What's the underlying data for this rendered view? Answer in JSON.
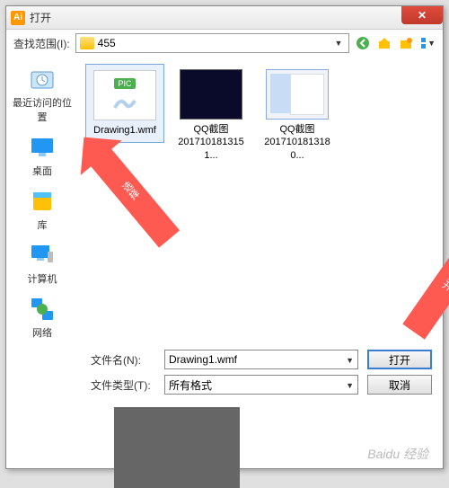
{
  "title": "打开",
  "search": {
    "label": "查找范围(I):",
    "current_folder": "455"
  },
  "toolbar_icons": {
    "back": "back-icon",
    "up": "up-icon",
    "new": "new-folder-icon",
    "views": "views-icon"
  },
  "places": [
    {
      "label": "最近访问的位置",
      "icon": "recent-icon"
    },
    {
      "label": "桌面",
      "icon": "desktop-icon"
    },
    {
      "label": "库",
      "icon": "libraries-icon"
    },
    {
      "label": "计算机",
      "icon": "computer-icon"
    },
    {
      "label": "网络",
      "icon": "network-icon"
    }
  ],
  "files": [
    {
      "name": "Drawing1.wmf",
      "selected": true,
      "thumb": "pic"
    },
    {
      "name": "QQ截图\n2017101813151...",
      "selected": false,
      "thumb": "dark"
    },
    {
      "name": "QQ截图\n2017101813180...",
      "selected": false,
      "thumb": "window"
    }
  ],
  "form": {
    "filename_label": "文件名(N):",
    "filename_value": "Drawing1.wmf",
    "filetype_label": "文件类型(T):",
    "filetype_value": "所有格式",
    "open_btn": "打开",
    "cancel_btn": "取消"
  },
  "annotations": {
    "arrow1_text": "选择",
    "arrow2_text": "打开"
  },
  "watermark": "Baidu 经验",
  "colors": {
    "accent": "#3a7bd5",
    "danger": "#c0392b",
    "arrow": "#ff5a52"
  }
}
